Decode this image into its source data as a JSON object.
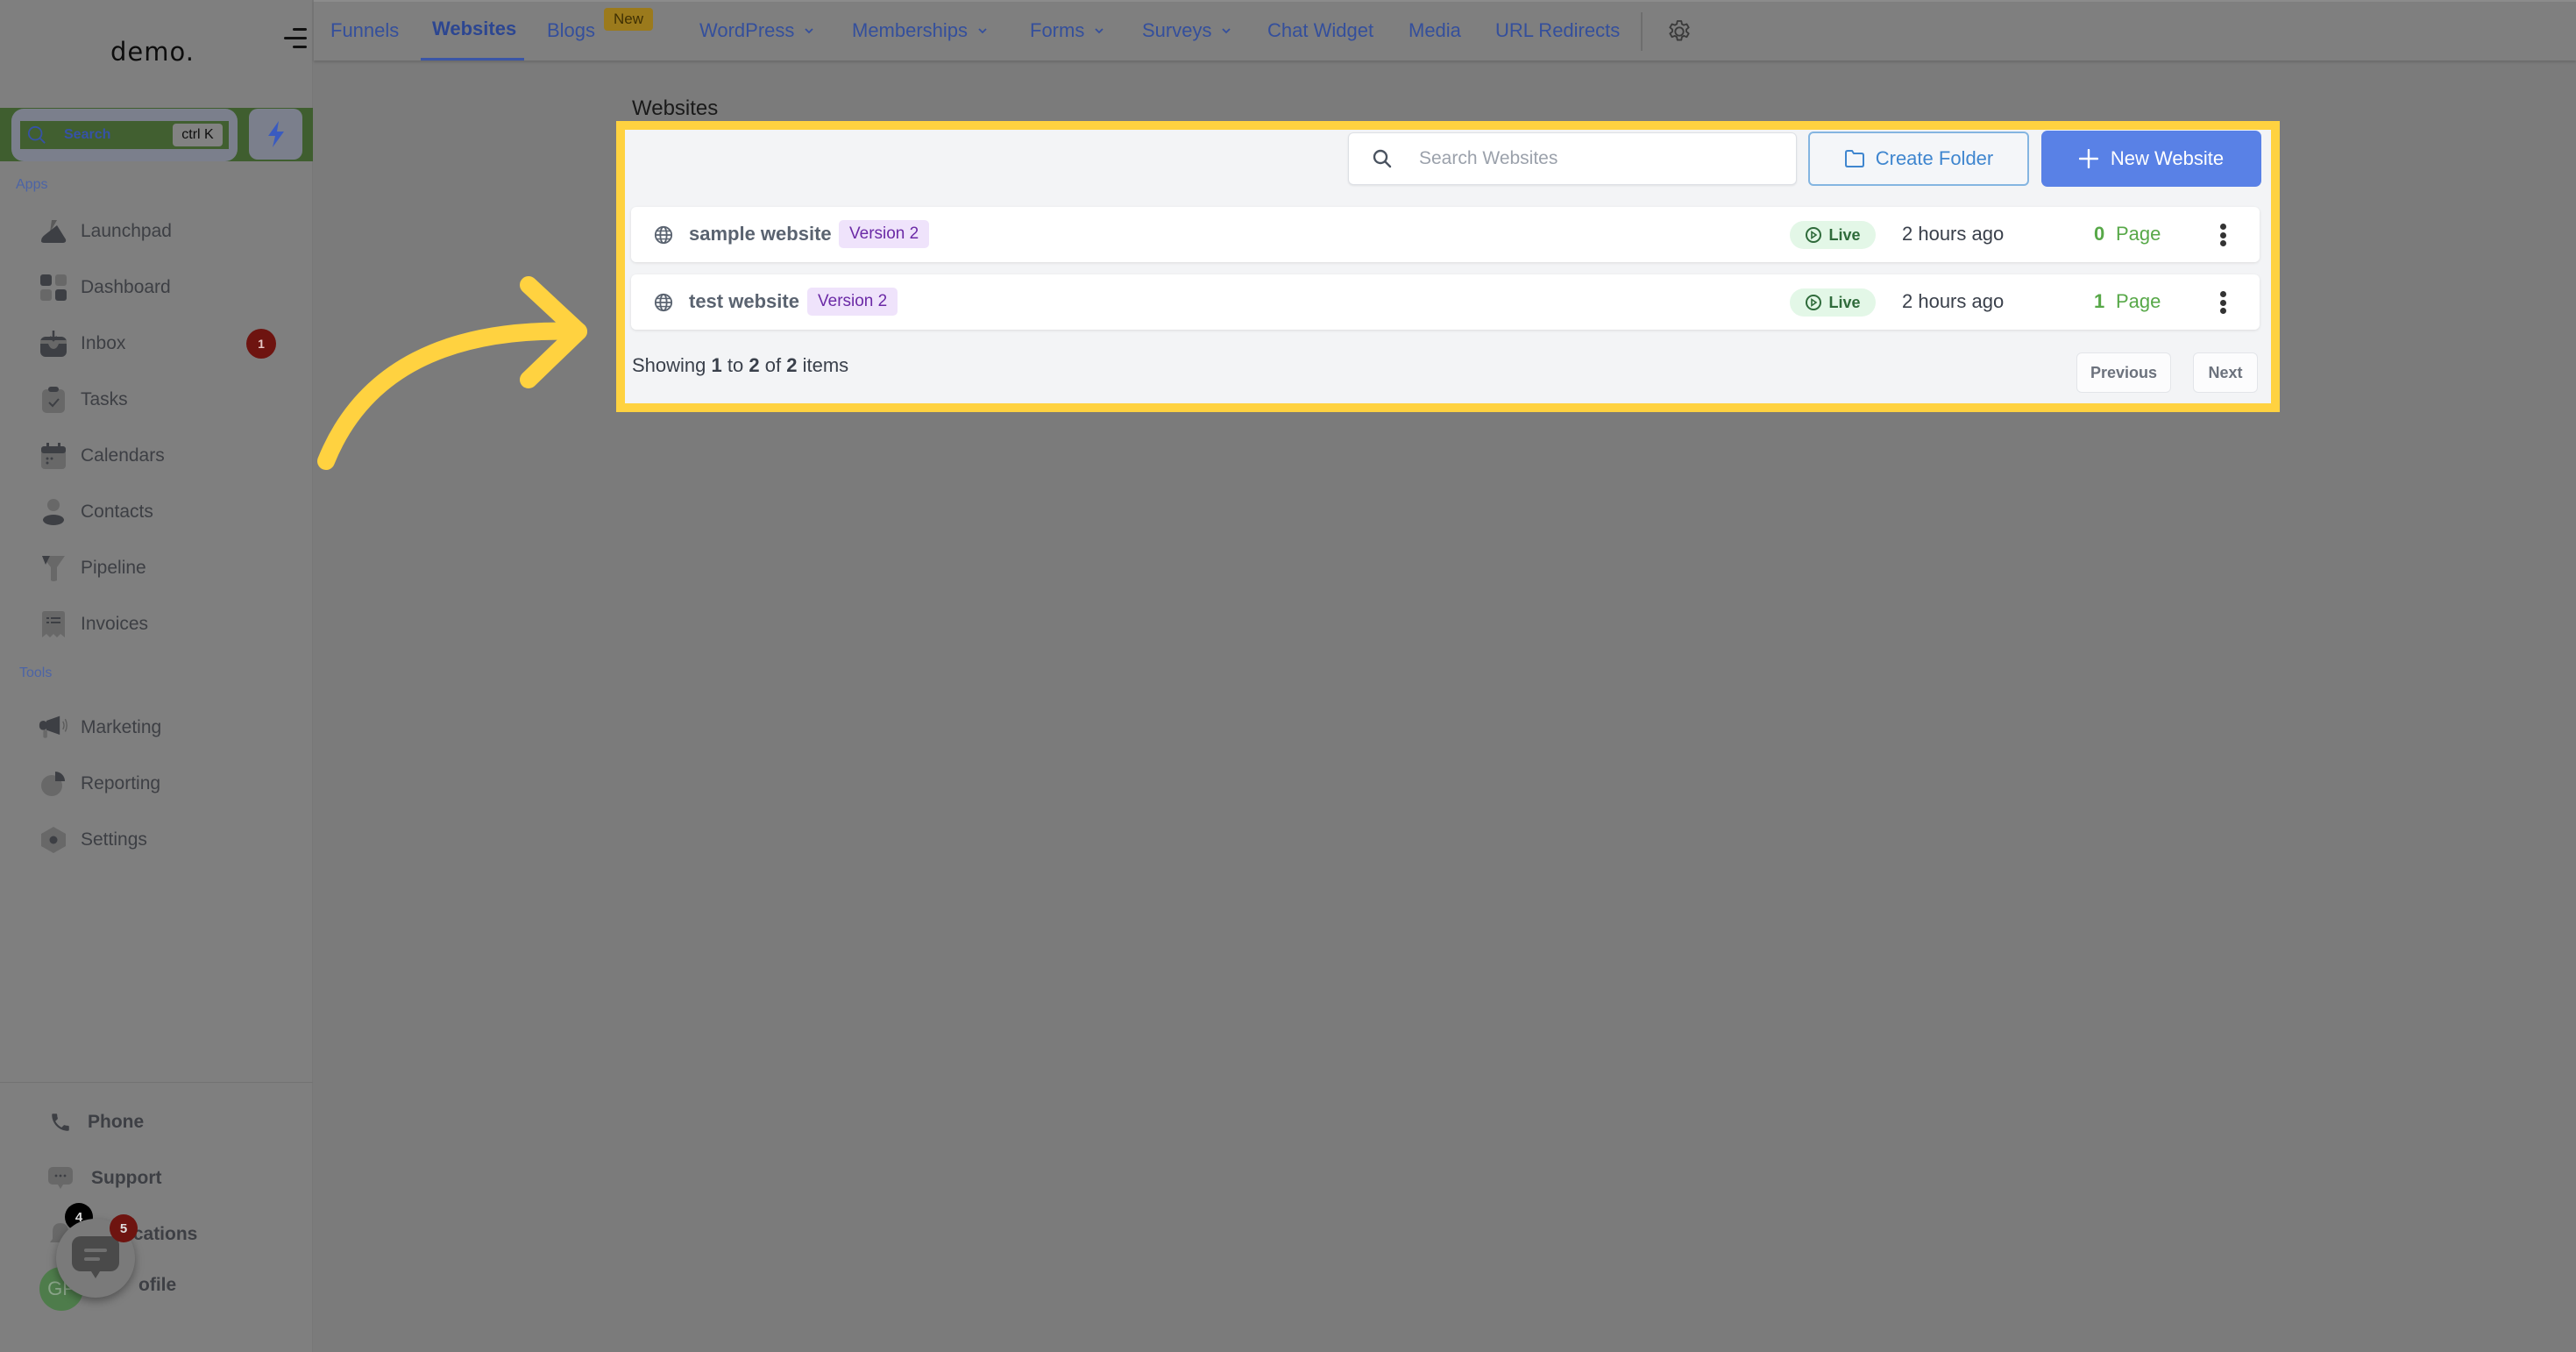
{
  "sidebar": {
    "logo": "demo.",
    "search": {
      "label": "Search",
      "shortcut": "ctrl K"
    },
    "sections": [
      {
        "label": "Apps"
      },
      {
        "label": "Tools"
      }
    ],
    "apps": [
      {
        "label": "Launchpad",
        "icon": "launchpad-icon"
      },
      {
        "label": "Dashboard",
        "icon": "dashboard-icon"
      },
      {
        "label": "Inbox",
        "icon": "inbox-icon",
        "badge": "1"
      },
      {
        "label": "Tasks",
        "icon": "tasks-icon"
      },
      {
        "label": "Calendars",
        "icon": "calendar-icon"
      },
      {
        "label": "Contacts",
        "icon": "contacts-icon"
      },
      {
        "label": "Pipeline",
        "icon": "pipeline-icon"
      },
      {
        "label": "Invoices",
        "icon": "invoices-icon"
      }
    ],
    "tools": [
      {
        "label": "Marketing",
        "icon": "megaphone-icon"
      },
      {
        "label": "Reporting",
        "icon": "pie-chart-icon"
      },
      {
        "label": "Settings",
        "icon": "settings-icon"
      }
    ],
    "bottom": [
      {
        "label": "Phone",
        "icon": "phone-icon"
      },
      {
        "label": "Support",
        "icon": "support-chat-icon"
      },
      {
        "label": "Notifications",
        "visible_label": "ications",
        "icon": "bell-icon",
        "badge": "4"
      },
      {
        "label": "Profile",
        "visible_label": "ofile",
        "avatar_initials": "GP"
      }
    ],
    "chat_widget_badge": "5"
  },
  "topbar": {
    "tabs": [
      {
        "label": "Funnels",
        "active": false
      },
      {
        "label": "Websites",
        "active": true
      },
      {
        "label": "Blogs",
        "active": false,
        "pill": "New"
      },
      {
        "label": "WordPress",
        "active": false,
        "dropdown": true
      },
      {
        "label": "Memberships",
        "active": false,
        "dropdown": true
      },
      {
        "label": "Forms",
        "active": false,
        "dropdown": true
      },
      {
        "label": "Surveys",
        "active": false,
        "dropdown": true
      },
      {
        "label": "Chat Widget",
        "active": false
      },
      {
        "label": "Media",
        "active": false
      },
      {
        "label": "URL Redirects",
        "active": false
      }
    ]
  },
  "main": {
    "title": "Websites",
    "search": {
      "placeholder": "Search Websites",
      "value": ""
    },
    "create_folder_label": "Create Folder",
    "new_website_label": "New Website",
    "websites": [
      {
        "name": "sample website",
        "version": "Version 2",
        "status": "Live",
        "updated": "2 hours ago",
        "pages_count": "0",
        "pages_label": "Page"
      },
      {
        "name": "test website",
        "version": "Version 2",
        "status": "Live",
        "updated": "2 hours ago",
        "pages_count": "1",
        "pages_label": "Page"
      }
    ],
    "pagination": {
      "prefix": "Showing",
      "from": "1",
      "to_word": "to",
      "to": "2",
      "of_word": "of",
      "total": "2",
      "suffix": "items",
      "previous_label": "Previous",
      "next_label": "Next"
    }
  },
  "colors": {
    "highlight": "#ffd240",
    "primary": "#5981e6",
    "live_bg": "#e3f7e7",
    "version_bg": "#efe3fb",
    "pages_green": "#57a848"
  }
}
